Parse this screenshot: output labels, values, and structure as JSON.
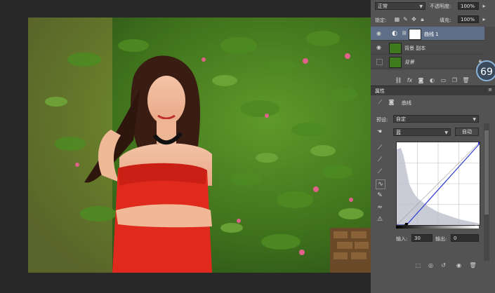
{
  "layers_panel": {
    "blend_mode": "正常",
    "opacity_label": "不透明度:",
    "opacity_value": "100%",
    "lock_label": "锁定:",
    "fill_label": "填充:",
    "fill_value": "100%",
    "layers": [
      {
        "name": "曲线 1",
        "selected": true
      },
      {
        "name": "背景 副本",
        "selected": false
      },
      {
        "name": "背景",
        "selected": false
      }
    ],
    "badge": "69"
  },
  "properties_panel": {
    "tab_label": "属性",
    "adjustment_name": "曲线",
    "preset_label": "预设:",
    "preset_value": "自定",
    "channel_value": "蓝",
    "auto_button": "自动",
    "input_label": "输入:",
    "input_value": "30",
    "output_label": "输出:",
    "output_value": "0"
  },
  "colors": {
    "panel_bg": "#535353",
    "selection": "#5f6e87",
    "dress_red": "#e02a1d",
    "foliage_green": "#3f7a1e",
    "curve_blue": "#2f3ad0"
  }
}
